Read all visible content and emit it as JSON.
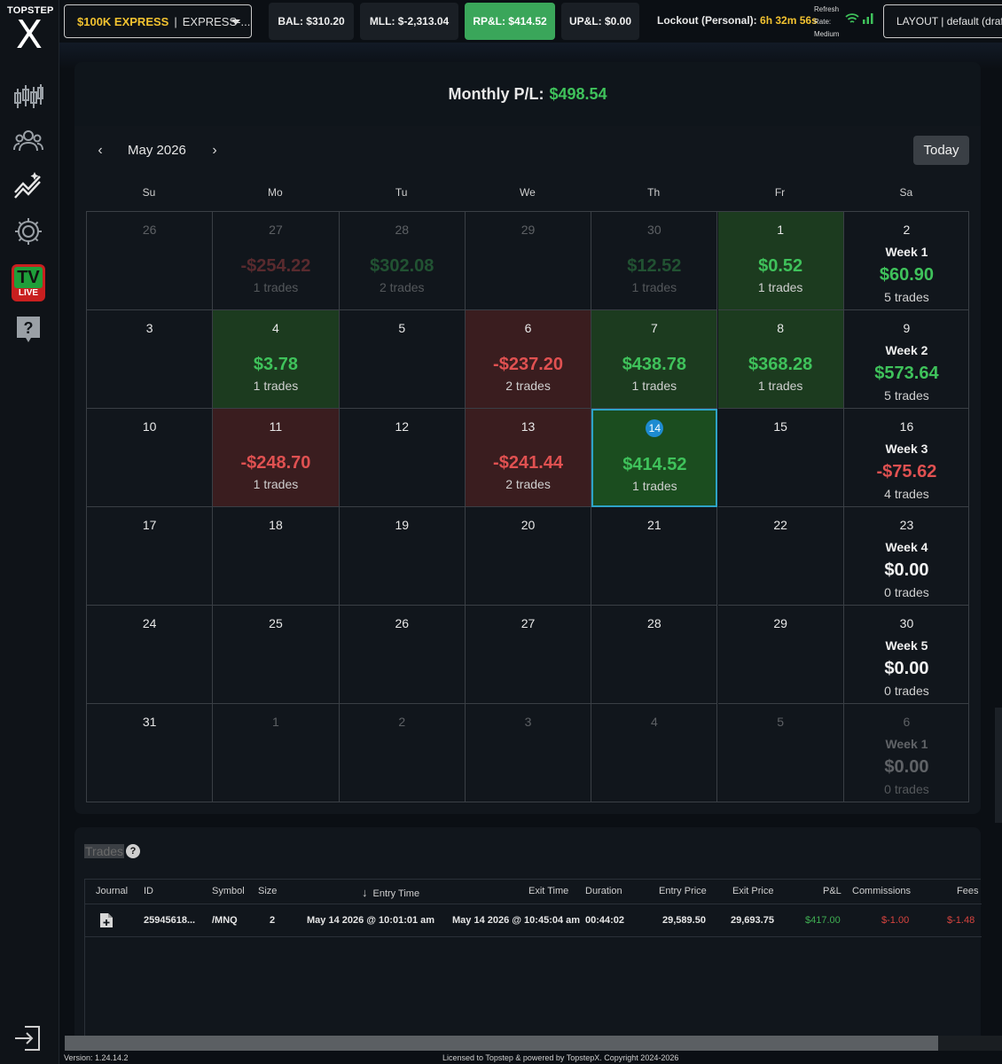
{
  "app": {
    "logo_top": "TOPSTEP",
    "logo_x": "X",
    "tv_label": "TV",
    "tv_live": "LIVE",
    "version": "Version: 1.24.14.2",
    "license": "Licensed to Topstep & powered by TopstepX. Copyright 2024-2026"
  },
  "topbar": {
    "account_name": "$100K EXPRESS",
    "account_sep": "|",
    "account_sub": "EXPRESS-...",
    "bal": "BAL: $310.20",
    "mll": "MLL: $-2,313.04",
    "rpl": "RP&L: $414.52",
    "upl": "UP&L: $0.00",
    "lockout_label": "Lockout (Personal):",
    "lockout_value": "6h 32m 56s",
    "refresh_line1": "Refresh",
    "refresh_line2": "Rate:",
    "refresh_line3": "Medium",
    "layout": "LAYOUT | default (draf"
  },
  "calendar": {
    "monthly_label": "Monthly P/L:",
    "monthly_value": "$498.54",
    "prev": "‹",
    "next": "›",
    "month": "May 2026",
    "today_button": "Today",
    "weekdays": [
      "Su",
      "Mo",
      "Tu",
      "We",
      "Th",
      "Fr",
      "Sa"
    ],
    "weeks": [
      [
        {
          "day": "26",
          "muted": true
        },
        {
          "day": "27",
          "muted": true,
          "amount": "-$254.22",
          "trades": "1 trades",
          "tone": "neg"
        },
        {
          "day": "28",
          "muted": true,
          "amount": "$302.08",
          "trades": "2 trades",
          "tone": "pos"
        },
        {
          "day": "29",
          "muted": true
        },
        {
          "day": "30",
          "muted": true,
          "amount": "$12.52",
          "trades": "1 trades",
          "tone": "pos"
        },
        {
          "day": "1",
          "amount": "$0.52",
          "trades": "1 trades",
          "tone": "pos",
          "bg": "green"
        },
        {
          "day": "2",
          "week": "Week 1",
          "week_amount": "$60.90",
          "week_trades": "5 trades",
          "tone": "pos"
        }
      ],
      [
        {
          "day": "3"
        },
        {
          "day": "4",
          "amount": "$3.78",
          "trades": "1 trades",
          "tone": "pos",
          "bg": "green"
        },
        {
          "day": "5"
        },
        {
          "day": "6",
          "amount": "-$237.20",
          "trades": "2 trades",
          "tone": "neg",
          "bg": "red"
        },
        {
          "day": "7",
          "amount": "$438.78",
          "trades": "1 trades",
          "tone": "pos",
          "bg": "green"
        },
        {
          "day": "8",
          "amount": "$368.28",
          "trades": "1 trades",
          "tone": "pos",
          "bg": "green"
        },
        {
          "day": "9",
          "week": "Week 2",
          "week_amount": "$573.64",
          "week_trades": "5 trades",
          "tone": "pos"
        }
      ],
      [
        {
          "day": "10"
        },
        {
          "day": "11",
          "amount": "-$248.70",
          "trades": "1 trades",
          "tone": "neg",
          "bg": "red"
        },
        {
          "day": "12"
        },
        {
          "day": "13",
          "amount": "-$241.44",
          "trades": "2 trades",
          "tone": "neg",
          "bg": "red"
        },
        {
          "day": "14",
          "amount": "$414.52",
          "trades": "1 trades",
          "tone": "pos",
          "bg": "today",
          "today": true
        },
        {
          "day": "15"
        },
        {
          "day": "16",
          "week": "Week 3",
          "week_amount": "-$75.62",
          "week_trades": "4 trades",
          "tone": "neg"
        }
      ],
      [
        {
          "day": "17"
        },
        {
          "day": "18"
        },
        {
          "day": "19"
        },
        {
          "day": "20"
        },
        {
          "day": "21"
        },
        {
          "day": "22"
        },
        {
          "day": "23",
          "week": "Week 4",
          "week_amount": "$0.00",
          "week_trades": "0 trades",
          "tone": "zero"
        }
      ],
      [
        {
          "day": "24"
        },
        {
          "day": "25"
        },
        {
          "day": "26"
        },
        {
          "day": "27"
        },
        {
          "day": "28"
        },
        {
          "day": "29"
        },
        {
          "day": "30",
          "week": "Week 5",
          "week_amount": "$0.00",
          "week_trades": "0 trades",
          "tone": "zero"
        }
      ],
      [
        {
          "day": "31"
        },
        {
          "day": "1",
          "muted": true
        },
        {
          "day": "2",
          "muted": true
        },
        {
          "day": "3",
          "muted": true
        },
        {
          "day": "4",
          "muted": true
        },
        {
          "day": "5",
          "muted": true
        },
        {
          "day": "6",
          "muted": true,
          "week": "Week 1",
          "week_amount": "$0.00",
          "week_trades": "0 trades",
          "tone": "zero"
        }
      ]
    ]
  },
  "trades": {
    "title": "Trades",
    "help": "?",
    "columns": {
      "journal": "Journal",
      "id": "ID",
      "symbol": "Symbol",
      "size": "Size",
      "entry_time": "Entry Time",
      "exit_time": "Exit Time",
      "duration": "Duration",
      "entry_price": "Entry Price",
      "exit_price": "Exit Price",
      "pnl": "P&L",
      "commissions": "Commissions",
      "fees": "Fees"
    },
    "sort_arrow": "↓",
    "rows": [
      {
        "id": "25945618...",
        "symbol": "/MNQ",
        "size": "2",
        "entry_time": "May 14 2026 @ 10:01:01 am",
        "exit_time": "May 14 2026 @ 10:45:04 am",
        "duration": "00:44:02",
        "entry_price": "29,589.50",
        "exit_price": "29,693.75",
        "pnl": "$417.00",
        "commissions": "$-1.00",
        "fees": "$-1.48"
      }
    ]
  },
  "colors": {
    "accent_yellow": "#f2c230",
    "positive": "#3fc25b",
    "negative": "#e05151",
    "active_tab": "#3aa65a",
    "today_border": "#2ea3c7"
  },
  "icons": [
    "candlestick-icon",
    "community-icon",
    "analytics-icon",
    "settings-icon",
    "tv-live-icon",
    "help-icon",
    "logout-icon",
    "journal-add-icon",
    "wifi-icon",
    "signal-bars-icon"
  ]
}
